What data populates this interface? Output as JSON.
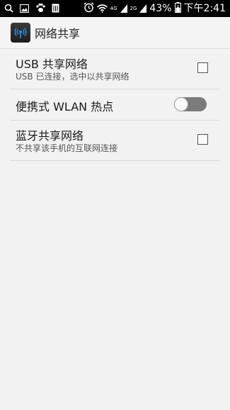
{
  "status_bar": {
    "time": "下午2:41",
    "battery_percent": "43%",
    "network_4g": "4G",
    "network_2g": "2G",
    "icons": [
      "search-icon",
      "image-icon",
      "paw-icon",
      "sim-icon",
      "alarm-icon",
      "wifi-icon",
      "signal-icon",
      "battery-icon"
    ]
  },
  "action_bar": {
    "title": "网络共享",
    "icon": "tethering-app-icon"
  },
  "settings": [
    {
      "title": "USB 共享网络",
      "subtitle": "USB 已连接，选中以共享网络",
      "control": "checkbox",
      "checked": false
    },
    {
      "title": "便携式 WLAN 热点",
      "control": "toggle",
      "on": false
    },
    {
      "title": "蓝牙共享网络",
      "subtitle": "不共享该手机的互联网连接",
      "control": "checkbox",
      "checked": false
    }
  ],
  "colors": {
    "background": "#f2f2f2",
    "status_bar": "#000000",
    "toggle_track": "#7b7b7b",
    "divider": "#d9d9d9"
  }
}
